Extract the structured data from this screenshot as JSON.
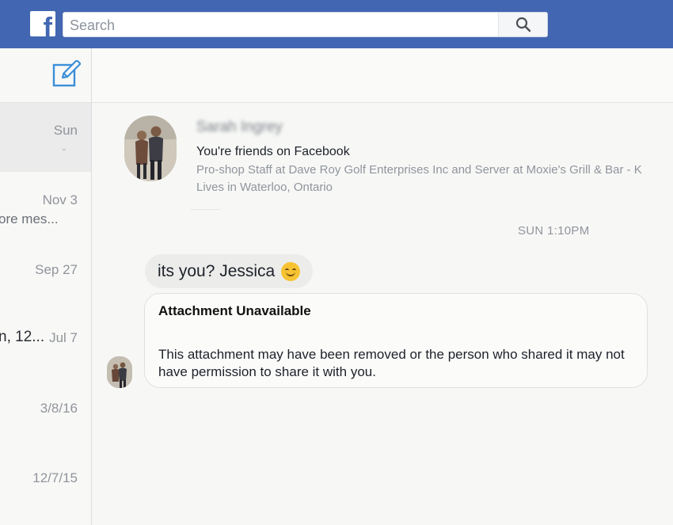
{
  "header": {
    "logo_letter": "f",
    "search_placeholder": "Search"
  },
  "sidebar": {
    "conversations": [
      {
        "date": "Sun",
        "snippet": "",
        "active": true
      },
      {
        "date": "Nov 3",
        "snippet": "ore mes..."
      },
      {
        "date": "Sep 27",
        "snippet": ""
      },
      {
        "date": "Jul 7",
        "snippet": "n, 12..."
      },
      {
        "date": "3/8/16",
        "snippet": ""
      },
      {
        "date": "12/7/15",
        "snippet": ""
      }
    ]
  },
  "profile": {
    "name": "Sarah Ingrey",
    "friends_text": "You're friends on Facebook",
    "work": "Pro-shop Staff at Dave Roy Golf Enterprises Inc and Server at Moxie's Grill & Bar - K",
    "lives": "Lives in Waterloo, Ontario"
  },
  "thread": {
    "timestamp": "SUN 1:10PM",
    "message_text": "its you?  Jessica",
    "emoji_icon": "smiling-face-icon",
    "attachment": {
      "title": "Attachment Unavailable",
      "body": "This attachment may have been removed or the person who shared it may not have permission to share it with you."
    }
  },
  "colors": {
    "brand_blue": "#4266b2",
    "compose_blue": "#3b8fd9"
  }
}
